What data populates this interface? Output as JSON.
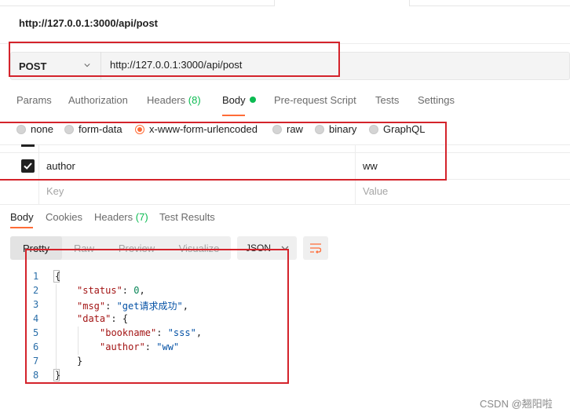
{
  "request": {
    "title": "http://127.0.0.1:3000/api/post",
    "method": "POST",
    "url": "http://127.0.0.1:3000/api/post"
  },
  "request_tabs": [
    {
      "label": "Params"
    },
    {
      "label": "Authorization"
    },
    {
      "label": "Headers",
      "count": "(8)"
    },
    {
      "label": "Body",
      "active": true,
      "indicator": "green-dot-icon"
    },
    {
      "label": "Pre-request Script"
    },
    {
      "label": "Tests"
    },
    {
      "label": "Settings"
    }
  ],
  "body_types": [
    {
      "label": "none"
    },
    {
      "label": "form-data"
    },
    {
      "label": "x-www-form-urlencoded",
      "selected": true
    },
    {
      "label": "raw"
    },
    {
      "label": "binary"
    },
    {
      "label": "GraphQL"
    }
  ],
  "params": {
    "rows": [
      {
        "checked": true,
        "key": "author",
        "value": "ww"
      }
    ],
    "key_placeholder": "Key",
    "value_placeholder": "Value"
  },
  "response_tabs": [
    {
      "label": "Body",
      "active": true
    },
    {
      "label": "Cookies"
    },
    {
      "label": "Headers",
      "count": "(7)"
    },
    {
      "label": "Test Results"
    }
  ],
  "view_modes": [
    {
      "label": "Pretty",
      "active": true
    },
    {
      "label": "Raw"
    },
    {
      "label": "Preview"
    },
    {
      "label": "Visualize"
    }
  ],
  "format": "JSON",
  "line_numbers": [
    "1",
    "2",
    "3",
    "4",
    "5",
    "6",
    "7",
    "8"
  ],
  "response_json": {
    "open_brace": "{",
    "status_key": "\"status\"",
    "status_val": "0",
    "msg_key": "\"msg\"",
    "msg_val": "\"get请求成功\"",
    "data_key": "\"data\"",
    "data_open": "{",
    "bookname_key": "\"bookname\"",
    "bookname_val": "\"sss\"",
    "author_key": "\"author\"",
    "author_val": "\"ww\"",
    "data_close": "}",
    "close_brace": "}"
  },
  "watermark": "CSDN @翘阳啦",
  "colors": {
    "accent": "#ff6c37",
    "indicator_green": "#0cbb52",
    "annotation_red": "#d4232b"
  }
}
